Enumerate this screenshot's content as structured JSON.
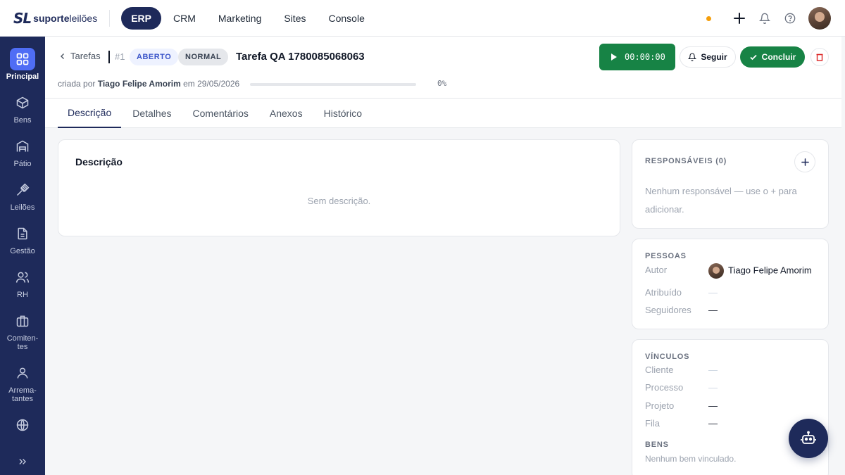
{
  "brand": {
    "mark": "SL",
    "name_bold": "suporte",
    "name_light": "leilões"
  },
  "top_nav": [
    {
      "label": "ERP",
      "active": true
    },
    {
      "label": "CRM",
      "active": false
    },
    {
      "label": "Marketing",
      "active": false
    },
    {
      "label": "Sites",
      "active": false
    },
    {
      "label": "Console",
      "active": false
    }
  ],
  "top_icons": [
    "status-dot-icon",
    "plus-icon",
    "bell-icon",
    "help-icon",
    "user-avatar"
  ],
  "sidebar": {
    "items": [
      {
        "label": "Principal",
        "icon": "grid-icon",
        "active": true
      },
      {
        "label": "Bens",
        "icon": "box-icon"
      },
      {
        "label": "Pátio",
        "icon": "warehouse-icon"
      },
      {
        "label": "Leilões",
        "icon": "gavel-icon"
      },
      {
        "label": "Gestão",
        "icon": "document-icon"
      },
      {
        "label": "RH",
        "icon": "people-icon"
      },
      {
        "label": "Comiten-\ntes",
        "icon": "briefcase-icon"
      },
      {
        "label": "Arrema-\ntantes",
        "icon": "person-icon"
      },
      {
        "label": "",
        "icon": "globe-icon"
      }
    ],
    "expand_icon": "chevrons-right-icon"
  },
  "header": {
    "back_label": "Tarefas",
    "task_number": "#1",
    "status_badge": "ABERTO",
    "priority_badge": "NORMAL",
    "title": "Tarefa QA 1780085068063",
    "timer": "00:00:00",
    "follow_label": "Seguir",
    "complete_label": "Concluir",
    "created_prefix": "criada por",
    "created_by": "Tiago Felipe Amorim",
    "created_mid": "em",
    "created_date": "29/05/2026",
    "progress_text": "0%",
    "progress_value": 0
  },
  "tabs": [
    {
      "label": "Descrição",
      "active": true
    },
    {
      "label": "Detalhes",
      "active": false
    },
    {
      "label": "Comentários",
      "active": false
    },
    {
      "label": "Anexos",
      "active": false
    },
    {
      "label": "Histórico",
      "active": false
    }
  ],
  "description": {
    "title": "Descrição",
    "empty": "Sem descrição."
  },
  "responsaveis": {
    "title": "RESPONSÁVEIS (0)",
    "empty": "Nenhum responsável — use o + para adicionar."
  },
  "pessoas": {
    "title": "PESSOAS",
    "autor_label": "Autor",
    "autor_value": "Tiago Felipe Amorim",
    "atribuido_label": "Atribuído",
    "atribuido_value": "—",
    "seguidores_label": "Seguidores",
    "seguidores_value": "—"
  },
  "vinculos": {
    "title": "VÍNCULOS",
    "cliente_label": "Cliente",
    "cliente_value": "—",
    "processo_label": "Processo",
    "processo_value": "—",
    "projeto_label": "Projeto",
    "projeto_value": "—",
    "fila_label": "Fila",
    "fila_value": "—",
    "bens_title": "BENS",
    "bens_empty": "Nenhum bem vinculado."
  },
  "assistant_icon": "robot-icon",
  "colors": {
    "primary": "#1e2a5a",
    "accent": "#4f6df5",
    "success": "#178345",
    "danger": "#dc2626",
    "warning": "#f59e0b"
  }
}
